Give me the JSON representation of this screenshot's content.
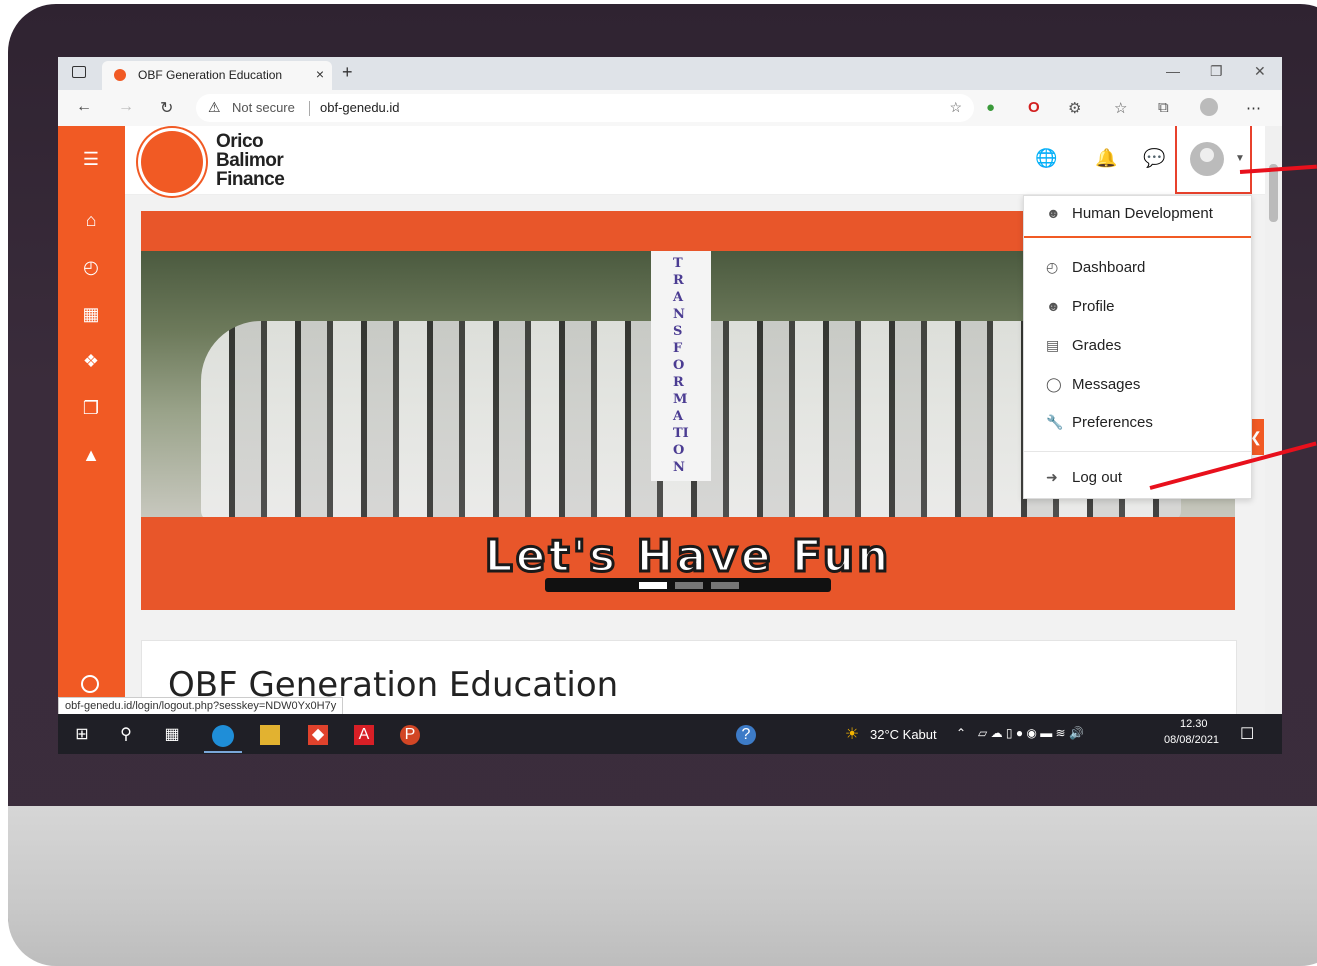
{
  "browser": {
    "tab_title": "OBF Generation Education",
    "tab_close": "×",
    "new_tab": "+",
    "not_secure": "Not secure",
    "url": "obf-genedu.id",
    "status_url": "obf-genedu.id/login/logout.php?sesskey=NDW0Yx0H7y"
  },
  "site": {
    "logo_line1": "Orico",
    "logo_line2": "Balimor",
    "logo_line3": "Finance",
    "banner_text": "Let's Have Fun",
    "banner_flag_text": "TRANSFORMATION",
    "content_title": "OBF Generation Education",
    "accent_color": "#f15a24"
  },
  "user_menu": {
    "header": "Human Development",
    "items": [
      {
        "label": "Dashboard",
        "icon": "dashboard-icon"
      },
      {
        "label": "Profile",
        "icon": "user-icon"
      },
      {
        "label": "Grades",
        "icon": "grades-icon"
      },
      {
        "label": "Messages",
        "icon": "message-icon"
      },
      {
        "label": "Preferences",
        "icon": "wrench-icon"
      }
    ],
    "logout": "Log out"
  },
  "taskbar": {
    "weather": "32°C  Kabut",
    "time": "12.30",
    "date": "08/08/2021"
  }
}
